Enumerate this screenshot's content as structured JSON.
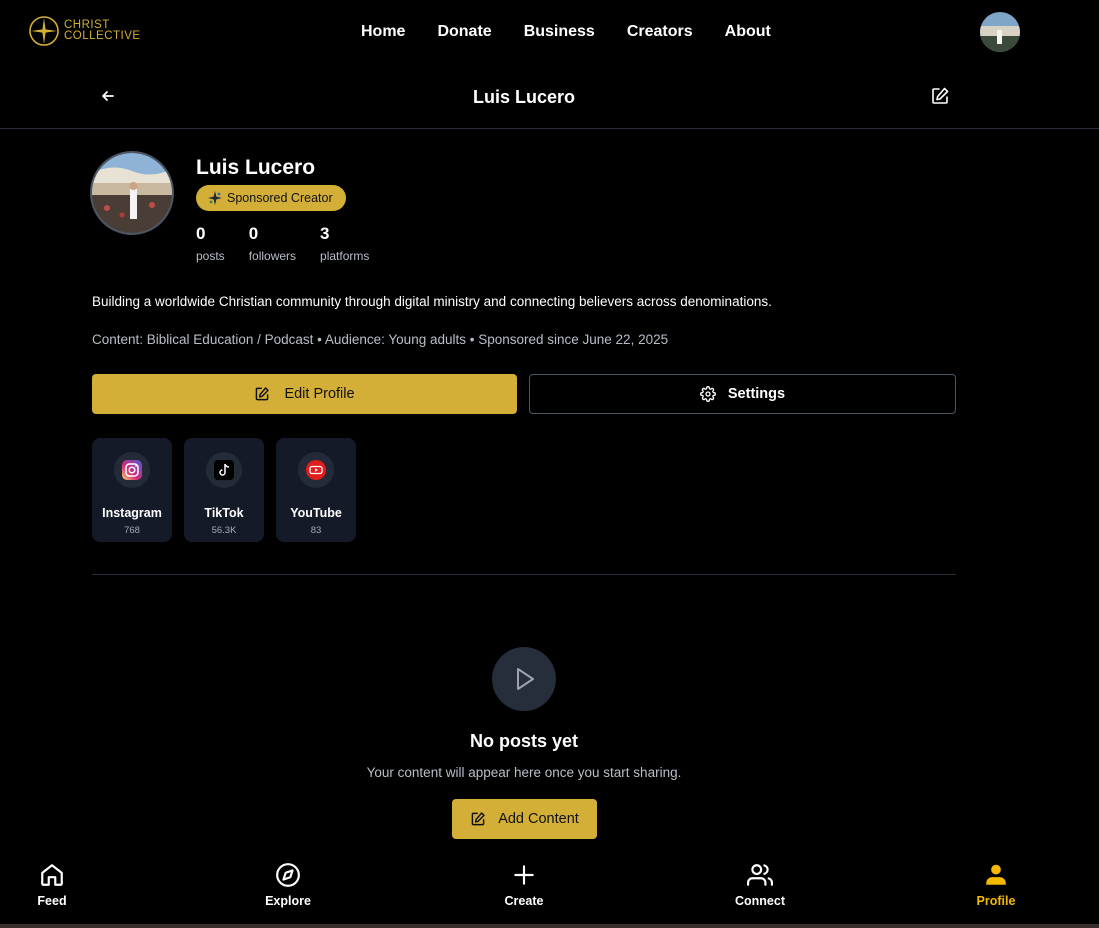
{
  "brand": {
    "line1": "CHRIST",
    "line2": "COLLECTIVE",
    "color": "#d4af37"
  },
  "nav": {
    "links": [
      "Home",
      "Donate",
      "Business",
      "Creators",
      "About"
    ]
  },
  "header": {
    "title": "Luis Lucero"
  },
  "profile": {
    "name": "Luis Lucero",
    "badge": "Sponsored Creator",
    "stats": [
      {
        "value": "0",
        "label": "posts"
      },
      {
        "value": "0",
        "label": "followers"
      },
      {
        "value": "3",
        "label": "platforms"
      }
    ],
    "bio": "Building a worldwide Christian community through digital ministry and connecting believers across denominations.",
    "meta": "Content: Biblical Education / Podcast • Audience: Young adults • Sponsored since June 22, 2025"
  },
  "actions": {
    "edit_label": "Edit Profile",
    "settings_label": "Settings"
  },
  "platforms": [
    {
      "name": "Instagram",
      "count": "768",
      "icon": "instagram-icon"
    },
    {
      "name": "TikTok",
      "count": "56.3K",
      "icon": "tiktok-icon"
    },
    {
      "name": "YouTube",
      "count": "83",
      "icon": "youtube-icon"
    }
  ],
  "empty": {
    "title": "No posts yet",
    "subtitle": "Your content will appear here once you start sharing.",
    "button": "Add Content"
  },
  "bottom_nav": [
    {
      "label": "Feed",
      "icon": "home-icon"
    },
    {
      "label": "Explore",
      "icon": "compass-icon"
    },
    {
      "label": "Create",
      "icon": "plus-icon"
    },
    {
      "label": "Connect",
      "icon": "users-icon"
    },
    {
      "label": "Profile",
      "icon": "user-icon",
      "active": true
    }
  ],
  "colors": {
    "accent": "#d4af37",
    "active_nav": "#f5b800",
    "card_bg": "#141a28"
  }
}
